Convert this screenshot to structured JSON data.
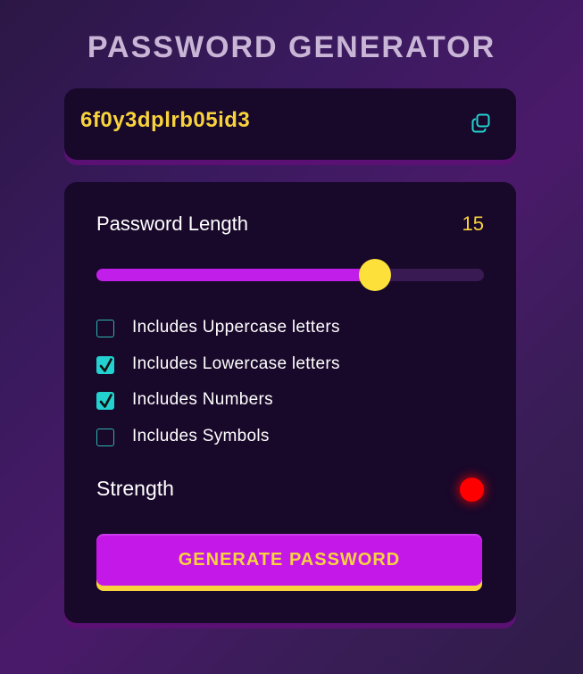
{
  "app": {
    "title": "PASSWORD GENERATOR"
  },
  "display": {
    "password": "6f0y3dplrb05id3",
    "copy_icon": "copy-icon"
  },
  "settings": {
    "length_label": "Password Length",
    "length_value": "15",
    "slider": {
      "min": 0,
      "max": 20,
      "value": 15,
      "fill_fraction": 0.72
    },
    "options": [
      {
        "label": "Includes Uppercase letters",
        "checked": false
      },
      {
        "label": "Includes Lowercase letters",
        "checked": true
      },
      {
        "label": "Includes Numbers",
        "checked": true
      },
      {
        "label": "Includes Symbols",
        "checked": false
      }
    ],
    "strength_label": "Strength",
    "strength_level": "weak"
  },
  "actions": {
    "generate_label": "GENERATE PASSWORD"
  },
  "colors": {
    "accent_yellow": "#f8d33c",
    "accent_purple": "#c418e8",
    "checkbox_teal": "#23d2d0",
    "strength_red": "#ff0000",
    "card_bg": "#18082a"
  }
}
